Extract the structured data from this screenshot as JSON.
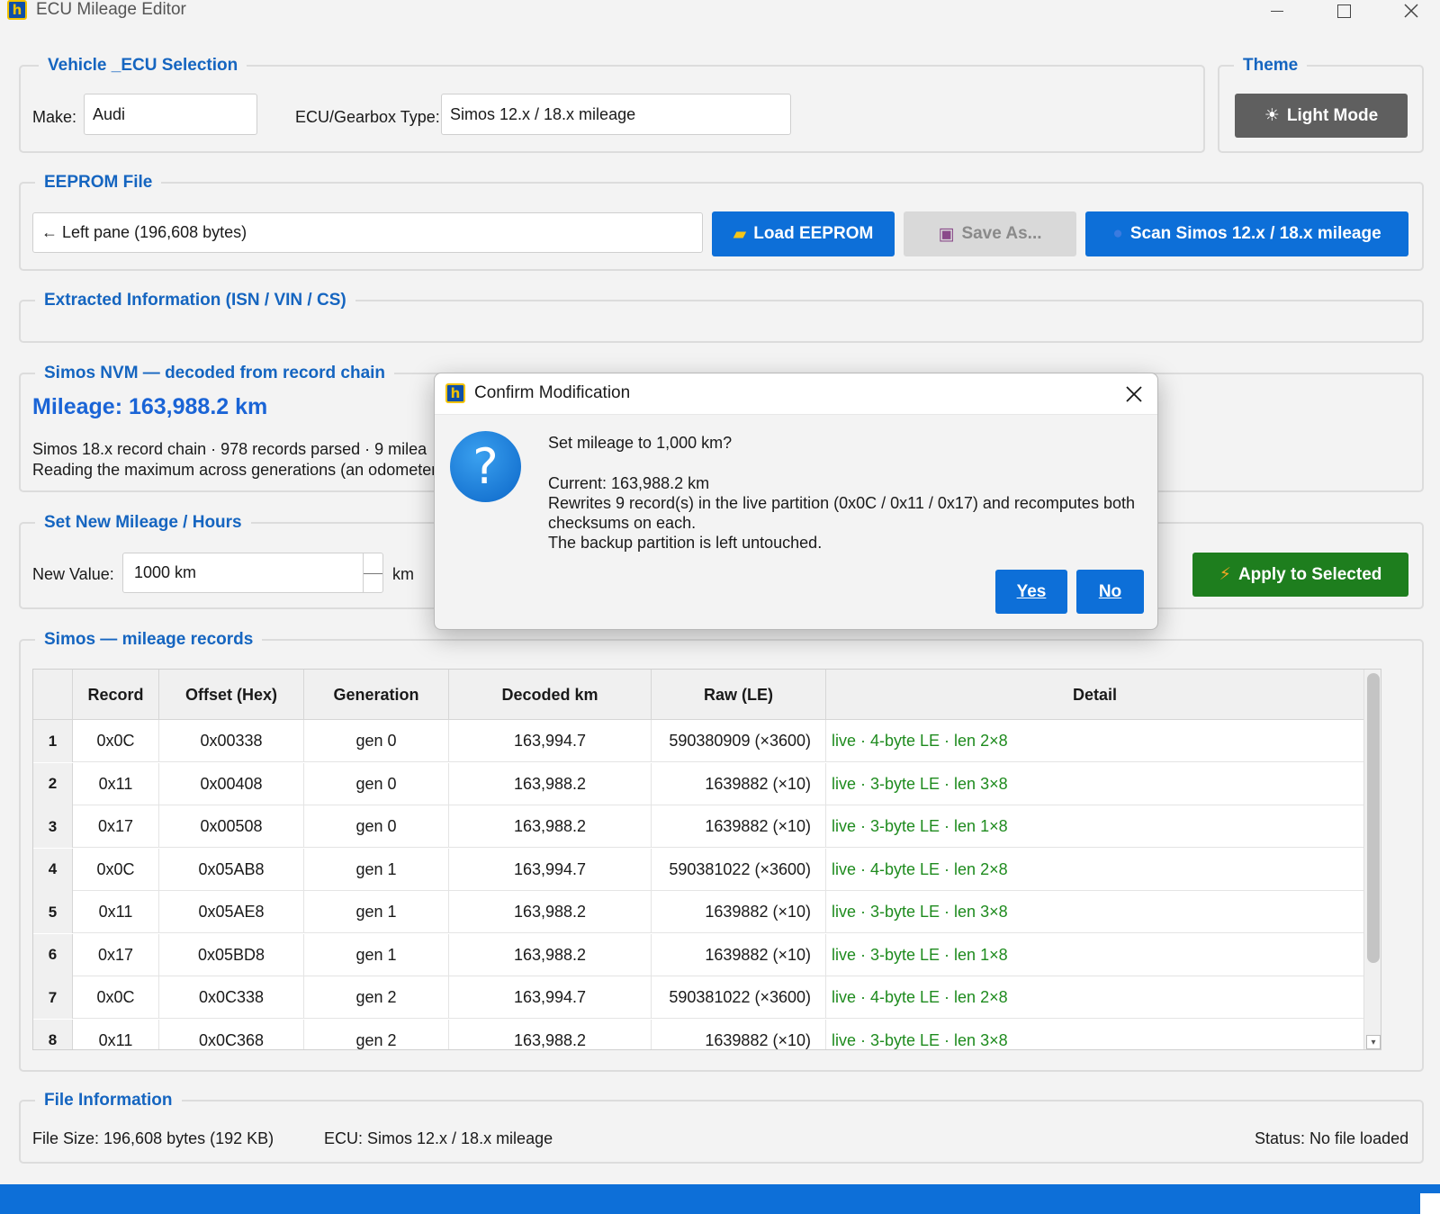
{
  "window": {
    "title": "ECU Mileage Editor",
    "app_icon_glyph": "h"
  },
  "vehicle": {
    "legend": "Vehicle _ECU Selection",
    "make_label": "Make:",
    "make_value": "Audi",
    "ecu_label": "ECU/Gearbox Type:",
    "ecu_value": "Simos 12.x / 18.x mileage"
  },
  "theme": {
    "legend": "Theme",
    "button_label": "Light Mode",
    "button_icon": "sun-icon"
  },
  "eeprom": {
    "legend": "EEPROM File",
    "file_value": "← Left pane (196,608 bytes)",
    "load_label": "Load EEPROM",
    "save_label": "Save As...",
    "scan_label": "Scan Simos 12.x / 18.x mileage"
  },
  "extracted": {
    "legend": "Extracted Information (ISN / VIN / CS)"
  },
  "nvm": {
    "legend": "Simos NVM — decoded from record chain",
    "mileage": "Mileage: 163,988.2 km",
    "line1": "Simos 18.x record chain  ·  978 records parsed  ·  9 milea",
    "line2": "Reading the maximum across generations (an odometer"
  },
  "set_mileage": {
    "legend": "Set New Mileage / Hours",
    "new_value_label": "New Value:",
    "new_value": "1000 km",
    "unit": "km",
    "apply_label": "Apply to Selected"
  },
  "records": {
    "legend": "Simos — mileage records",
    "columns": [
      "Record",
      "Offset (Hex)",
      "Generation",
      "Decoded km",
      "Raw (LE)",
      "Detail"
    ],
    "rows": [
      {
        "n": "1",
        "record": "0x0C",
        "offset": "0x00338",
        "gen": "gen 0",
        "km": "163,994.7",
        "raw": "590380909 (×3600)",
        "detail": "live  ·  4-byte LE  ·  len 2×8"
      },
      {
        "n": "2",
        "record": "0x11",
        "offset": "0x00408",
        "gen": "gen 0",
        "km": "163,988.2",
        "raw": "1639882 (×10)",
        "detail": "live  ·  3-byte LE  ·  len 3×8"
      },
      {
        "n": "3",
        "record": "0x17",
        "offset": "0x00508",
        "gen": "gen 0",
        "km": "163,988.2",
        "raw": "1639882 (×10)",
        "detail": "live  ·  3-byte LE  ·  len 1×8"
      },
      {
        "n": "4",
        "record": "0x0C",
        "offset": "0x05AB8",
        "gen": "gen 1",
        "km": "163,994.7",
        "raw": "590381022 (×3600)",
        "detail": "live  ·  4-byte LE  ·  len 2×8"
      },
      {
        "n": "5",
        "record": "0x11",
        "offset": "0x05AE8",
        "gen": "gen 1",
        "km": "163,988.2",
        "raw": "1639882 (×10)",
        "detail": "live  ·  3-byte LE  ·  len 3×8"
      },
      {
        "n": "6",
        "record": "0x17",
        "offset": "0x05BD8",
        "gen": "gen 1",
        "km": "163,988.2",
        "raw": "1639882 (×10)",
        "detail": "live  ·  3-byte LE  ·  len 1×8"
      },
      {
        "n": "7",
        "record": "0x0C",
        "offset": "0x0C338",
        "gen": "gen 2",
        "km": "163,994.7",
        "raw": "590381022 (×3600)",
        "detail": "live  ·  4-byte LE  ·  len 2×8"
      },
      {
        "n": "8",
        "record": "0x11",
        "offset": "0x0C368",
        "gen": "gen 2",
        "km": "163,988.2",
        "raw": "1639882 (×10)",
        "detail": "live  ·  3-byte LE  ·  len 3×8"
      }
    ]
  },
  "file_info": {
    "legend": "File Information",
    "size": "File Size: 196,608 bytes  (192 KB)",
    "ecu": "ECU: Simos 12.x / 18.x mileage",
    "status": "Status: No file loaded"
  },
  "dialog": {
    "title": "Confirm Modification",
    "question": "Set mileage to 1,000 km?",
    "current": "Current: 163,988.2 km",
    "rewrite_line1": "Rewrites 9 record(s) in the live partition (0x0C / 0x11 / 0x17) and recomputes both",
    "rewrite_line2": "checksums on each.",
    "backup": "The backup partition is left untouched.",
    "yes_label": "Yes",
    "no_label": "No",
    "icon": "question-icon"
  },
  "colors": {
    "accent": "#0d6fd8",
    "legend": "#1565c0",
    "mileage": "#1a64d6",
    "apply": "#1e7e1e",
    "detail": "#1e8b1e"
  }
}
